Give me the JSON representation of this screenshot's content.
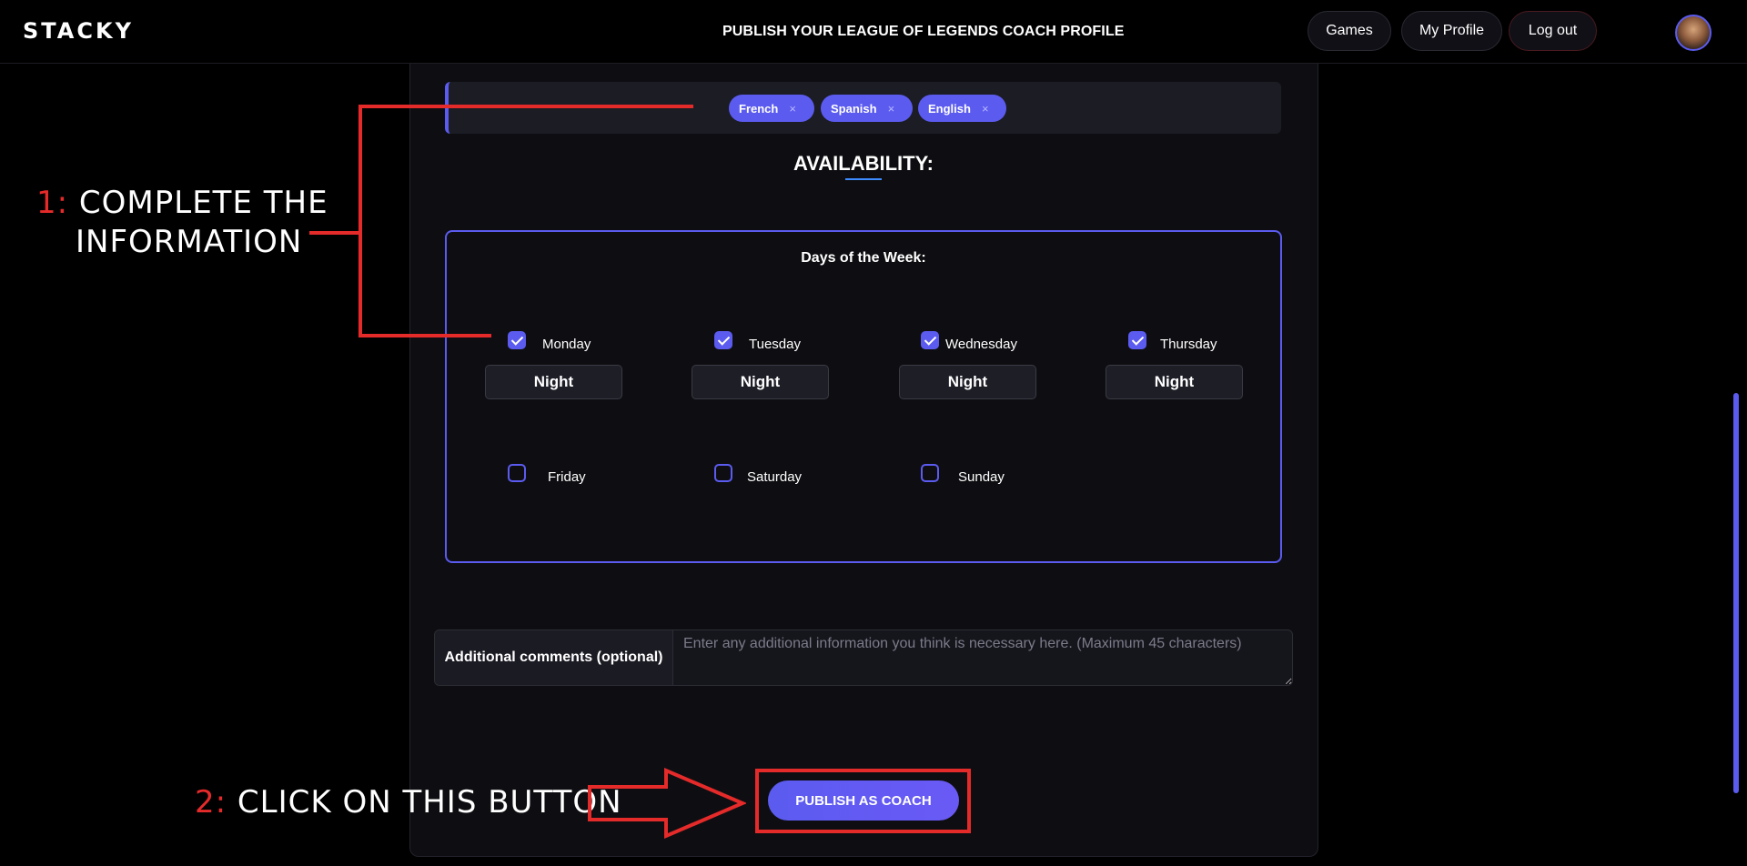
{
  "header": {
    "logo": "STACKY",
    "title": "PUBLISH YOUR LEAGUE OF LEGENDS COACH PROFILE",
    "nav": {
      "games": "Games",
      "my_profile": "My Profile",
      "log_out": "Log out"
    }
  },
  "languages": {
    "chips": [
      {
        "label": "French",
        "remove": "×"
      },
      {
        "label": "Spanish",
        "remove": "×"
      },
      {
        "label": "English",
        "remove": "×"
      }
    ]
  },
  "availability": {
    "title": "AVAILABILITY:",
    "days_title": "Days of the Week:",
    "days": [
      {
        "label": "Monday",
        "checked": true,
        "time": "Night"
      },
      {
        "label": "Tuesday",
        "checked": true,
        "time": "Night"
      },
      {
        "label": "Wednesday",
        "checked": true,
        "time": "Night"
      },
      {
        "label": "Thursday",
        "checked": true,
        "time": "Night"
      },
      {
        "label": "Friday",
        "checked": false
      },
      {
        "label": "Saturday",
        "checked": false
      },
      {
        "label": "Sunday",
        "checked": false
      }
    ]
  },
  "comments": {
    "label": "Additional comments (optional)",
    "placeholder": "Enter any additional information you think is necessary here. (Maximum 45 characters)",
    "value": ""
  },
  "publish": {
    "label": "PUBLISH AS COACH"
  },
  "annotations": {
    "step1_num": "1:",
    "step1_line1": "COMPLETE THE",
    "step1_line2": "INFORMATION",
    "step2_num": "2:",
    "step2_text": "CLICK ON THIS BUTTON"
  },
  "colors": {
    "accent": "#5b5bf0",
    "annotation_red": "#e52a2a",
    "background": "#000000",
    "panel": "#0e0e12"
  },
  "icons": {
    "chip_remove": "close-icon",
    "checkbox_checked": "checkmark-icon"
  }
}
